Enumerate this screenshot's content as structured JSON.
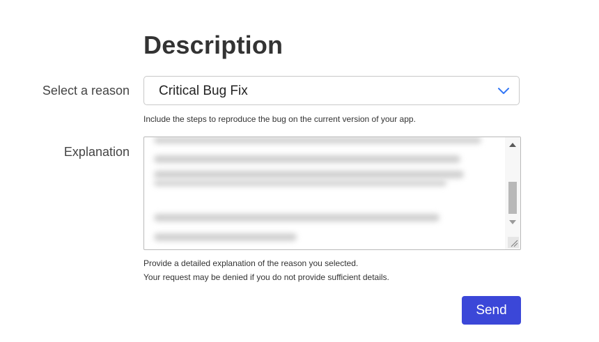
{
  "section": {
    "title": "Description"
  },
  "reason": {
    "label": "Select a reason",
    "selected": "Critical Bug Fix",
    "hint": "Include the steps to reproduce the bug on the current version of your app."
  },
  "explanation": {
    "label": "Explanation",
    "hint_line1": "Provide a detailed explanation of the reason you selected.",
    "hint_line2": "Your request may be denied if you do not provide sufficient details."
  },
  "actions": {
    "send_label": "Send"
  },
  "colors": {
    "accent": "#3b47d8",
    "chevron": "#3478f6"
  }
}
